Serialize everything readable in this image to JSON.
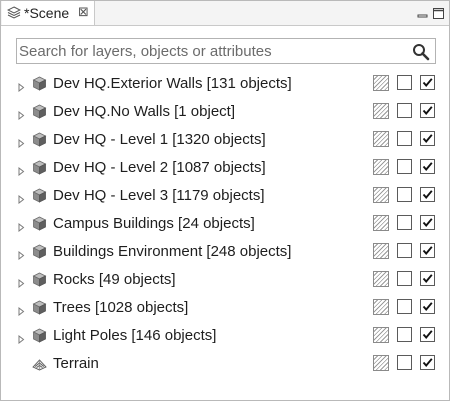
{
  "panel": {
    "tab_title": "*Scene",
    "tab_icon": "layers-icon",
    "close_icon": "close-icon",
    "minimize_icon": "minimize-icon",
    "maximize_icon": "maximize-icon"
  },
  "search": {
    "placeholder": "Search for layers, objects or attributes",
    "value": "",
    "icon": "search-icon"
  },
  "layers": [
    {
      "label": "Dev HQ.Exterior Walls [131 objects]",
      "icon": "cube-icon",
      "expandable": true,
      "visible": false,
      "checked": true
    },
    {
      "label": "Dev HQ.No Walls [1 object]",
      "icon": "cube-icon",
      "expandable": true,
      "visible": false,
      "checked": true
    },
    {
      "label": "Dev HQ - Level 1 [1320 objects]",
      "icon": "cube-icon",
      "expandable": true,
      "visible": false,
      "checked": true
    },
    {
      "label": "Dev HQ - Level 2 [1087 objects]",
      "icon": "cube-icon",
      "expandable": true,
      "visible": false,
      "checked": true
    },
    {
      "label": "Dev HQ - Level 3 [1179 objects]",
      "icon": "cube-icon",
      "expandable": true,
      "visible": false,
      "checked": true
    },
    {
      "label": "Campus Buildings [24 objects]",
      "icon": "cube-icon",
      "expandable": true,
      "visible": false,
      "checked": true
    },
    {
      "label": "Buildings Environment [248 objects]",
      "icon": "cube-icon",
      "expandable": true,
      "visible": false,
      "checked": true
    },
    {
      "label": "Rocks [49 objects]",
      "icon": "cube-icon",
      "expandable": true,
      "visible": false,
      "checked": true
    },
    {
      "label": "Trees [1028 objects]",
      "icon": "cube-icon",
      "expandable": true,
      "visible": false,
      "checked": true
    },
    {
      "label": "Light Poles [146 objects]",
      "icon": "cube-icon",
      "expandable": true,
      "visible": false,
      "checked": true
    },
    {
      "label": "Terrain",
      "icon": "terrain-icon",
      "expandable": false,
      "visible": false,
      "checked": true
    }
  ],
  "colors": {
    "border": "#b9b9b9",
    "titlebar": "#f4f4f4",
    "text": "#1e1e1e"
  }
}
